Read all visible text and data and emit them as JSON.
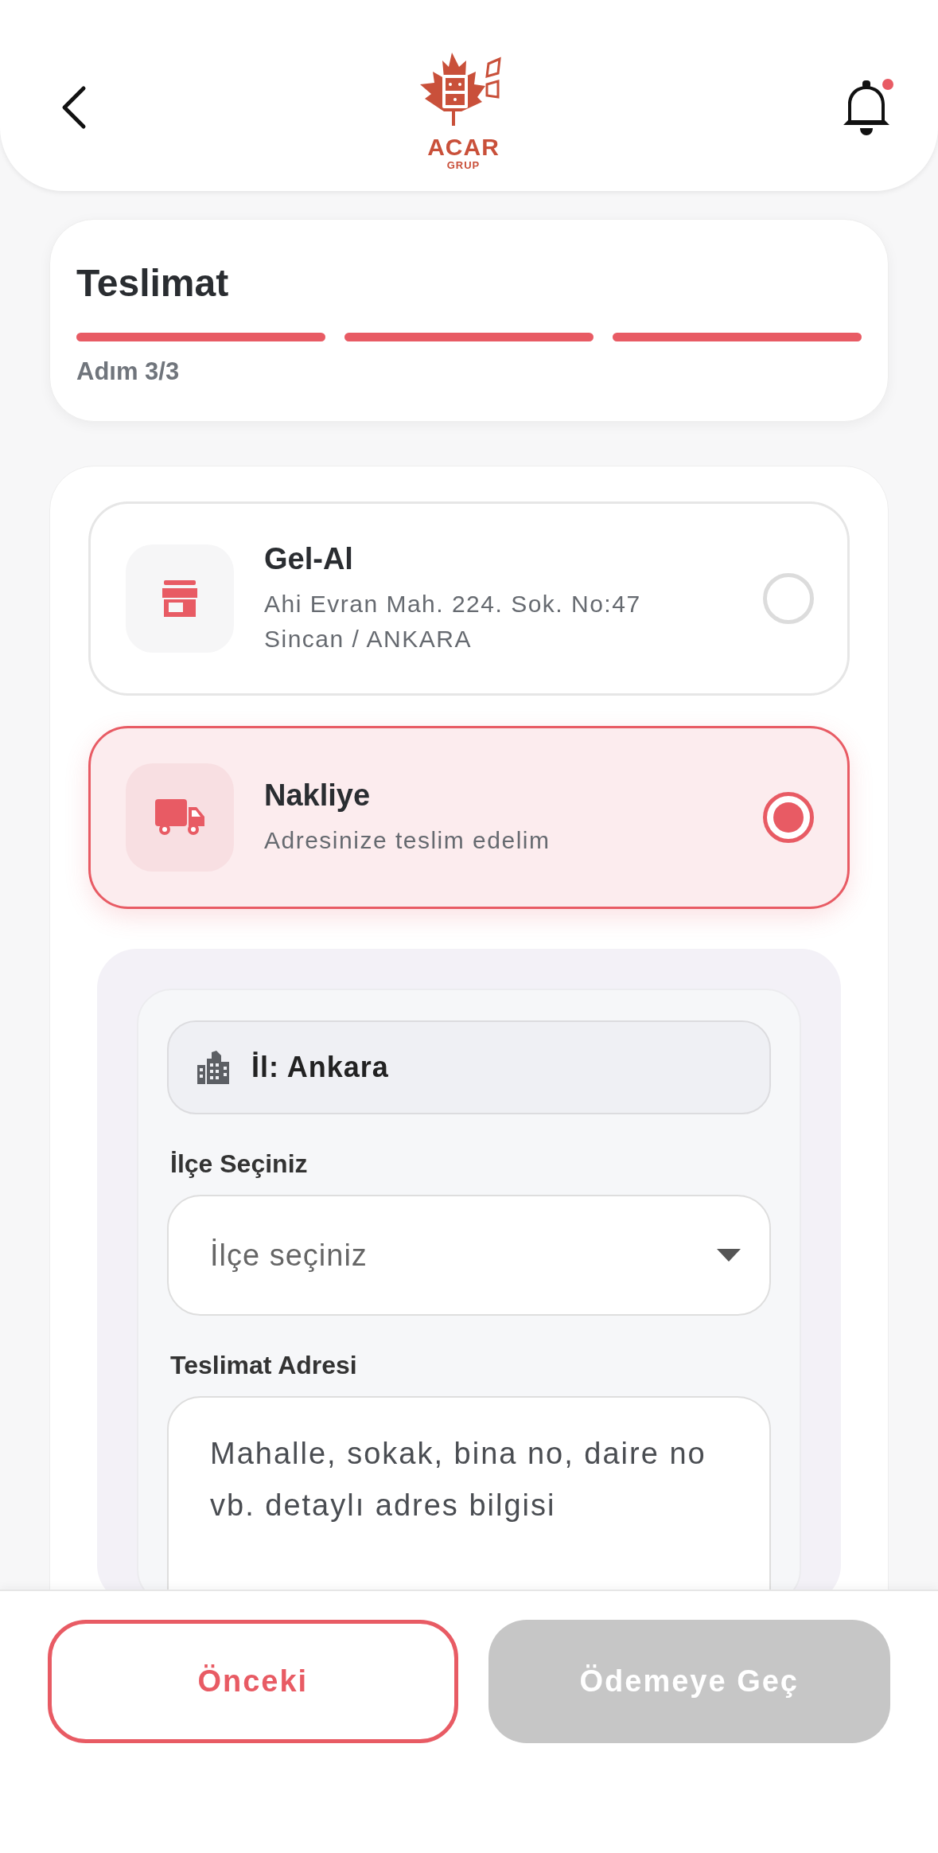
{
  "header": {
    "logo": {
      "title": "ACAR",
      "subtitle": "GRUP"
    },
    "has_unread": true
  },
  "step_card": {
    "title": "Teslimat",
    "steps": [
      {
        "done": true
      },
      {
        "done": true
      },
      {
        "done": true
      }
    ],
    "step_label": "Adım 3/3"
  },
  "delivery_options": [
    {
      "kind": "pickup",
      "title": "Gel-Al",
      "description": "Ahi Evran Mah. 224. Sok. No:47 Sincan / ANKARA",
      "selected": false
    },
    {
      "kind": "shipping",
      "title": "Nakliye",
      "description": "Adresinize teslim edelim",
      "selected": true
    }
  ],
  "address_form": {
    "province": "İl: Ankara",
    "district_label": "İlçe Seçiniz",
    "district_select": {
      "placeholder": "İlçe seçiniz"
    },
    "address_label": "Teslimat Adresi",
    "address_field": {
      "placeholder": "Mahalle, sokak, bina no, daire no vb. detaylı adres bilgisi"
    }
  },
  "buttons": [
    {
      "kind": "secondary",
      "label": "Önceki",
      "disabled": false
    },
    {
      "kind": "primary",
      "label": "Ödemeye Geç",
      "disabled": true
    }
  ]
}
